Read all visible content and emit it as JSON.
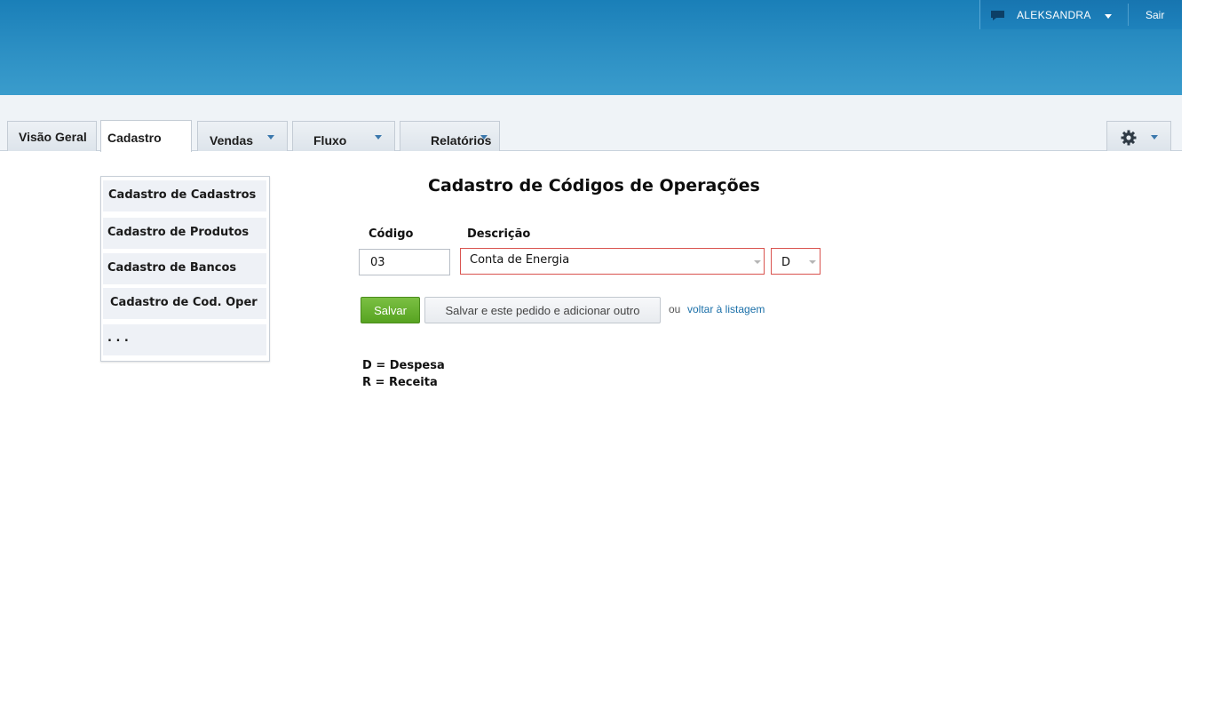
{
  "header": {
    "user_name": "ALEKSANDRA",
    "logout_label": "Sair"
  },
  "nav": {
    "tabs": [
      {
        "label": "Visão Geral"
      },
      {
        "label": "Cadastro"
      },
      {
        "label": "Vendas"
      },
      {
        "label": "Fluxo"
      },
      {
        "label": "Relatórios"
      }
    ],
    "active_tab": "Cadastro"
  },
  "dropdown": {
    "items": [
      {
        "label": "Cadastro de Cadastros"
      },
      {
        "label": "Cadastro de Produtos"
      },
      {
        "label": "Cadastro de Bancos"
      },
      {
        "label": "Cadastro de Cod. Oper"
      },
      {
        "label": ". . ."
      }
    ]
  },
  "form": {
    "title": "Cadastro de Códigos de Operações",
    "code_label": "Código",
    "code_value": "03",
    "description_label": "Descrição",
    "description_value": "Conta de Energia",
    "type_value": "D",
    "save_label": "Salvar",
    "save_add_label": "Salvar e este pedido e adicionar outro",
    "or_text": "ou",
    "back_link": "voltar à listagem"
  },
  "legend": {
    "line1": "D = Despesa",
    "line2": "R = Receita"
  },
  "colors": {
    "banner": "#2d90c4",
    "save_button": "#57a321",
    "error_border": "#d9534f",
    "link": "#1a6fa8"
  }
}
